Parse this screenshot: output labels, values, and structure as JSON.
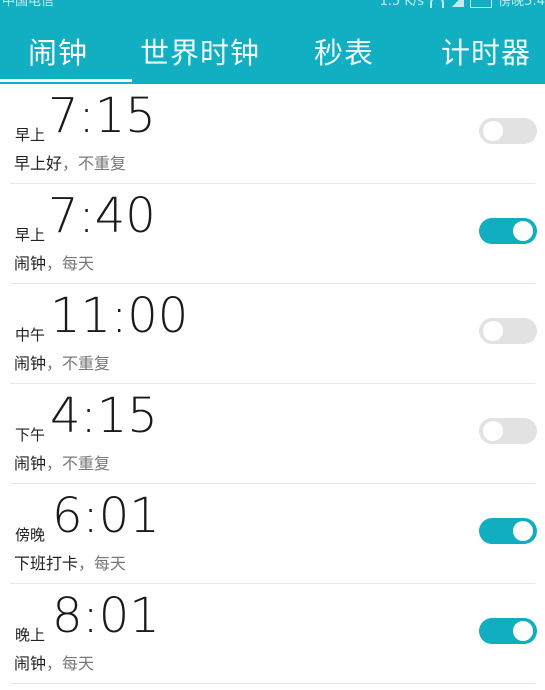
{
  "status_bar": {
    "carrier": "中国电信",
    "speed": "1.5 K/s",
    "time": "傍晚5:4"
  },
  "tabs": [
    {
      "label": "闹钟",
      "selected": true
    },
    {
      "label": "世界时钟",
      "selected": false
    },
    {
      "label": "秒表",
      "selected": false
    },
    {
      "label": "计时器",
      "selected": false
    }
  ],
  "alarms": [
    {
      "period": "早上",
      "time": "7:15",
      "name": "早上好",
      "repeat": "不重复",
      "enabled": false
    },
    {
      "period": "早上",
      "time": "7:40",
      "name": "闹钟",
      "repeat": "每天",
      "enabled": true
    },
    {
      "period": "中午",
      "time": "11:00",
      "name": "闹钟",
      "repeat": "不重复",
      "enabled": false
    },
    {
      "period": "下午",
      "time": "4:15",
      "name": "闹钟",
      "repeat": "不重复",
      "enabled": false
    },
    {
      "period": "傍晚",
      "time": "6:01",
      "name": "下班打卡",
      "repeat": "每天",
      "enabled": true
    },
    {
      "period": "晚上",
      "time": "8:01",
      "name": "闹钟",
      "repeat": "每天",
      "enabled": true
    }
  ],
  "separator": "，",
  "colors": {
    "accent": "#12aec2",
    "toggle_on": "#10aec0",
    "toggle_off": "#e2e2e2"
  }
}
